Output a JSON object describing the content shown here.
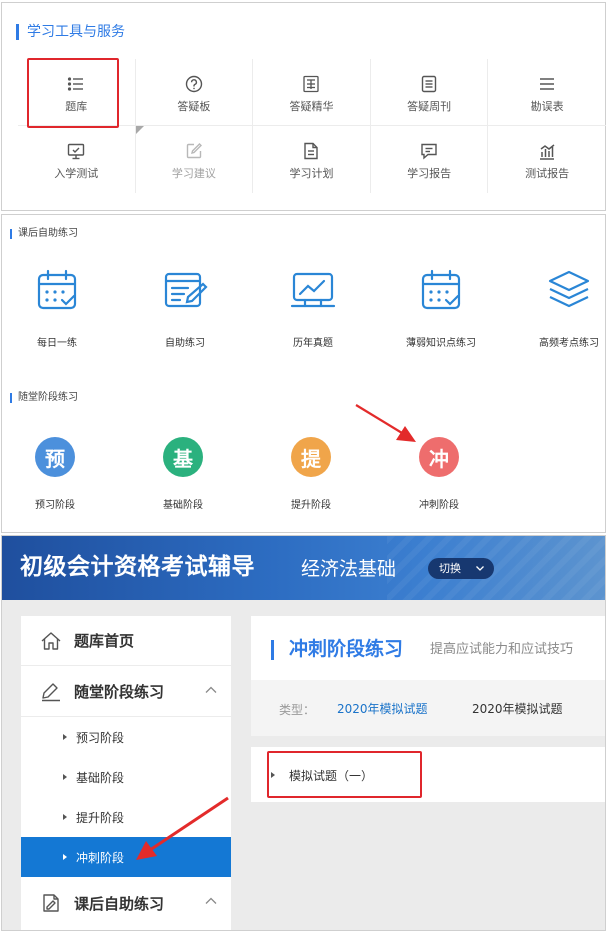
{
  "tools": {
    "title": "学习工具与服务",
    "items": [
      {
        "label": "题库",
        "icon": "list-icon"
      },
      {
        "label": "答疑板",
        "icon": "question-circle-icon"
      },
      {
        "label": "答疑精华",
        "icon": "essence-icon"
      },
      {
        "label": "答疑周刊",
        "icon": "document-icon"
      },
      {
        "label": "勘误表",
        "icon": "menu-lines-icon"
      },
      {
        "label": "入学测试",
        "icon": "monitor-icon"
      },
      {
        "label": "学习建议",
        "icon": "edit-icon"
      },
      {
        "label": "学习计划",
        "icon": "file-text-icon"
      },
      {
        "label": "学习报告",
        "icon": "message-icon"
      },
      {
        "label": "测试报告",
        "icon": "bar-chart-icon"
      }
    ]
  },
  "practice": {
    "after_class_title": "课后自助练习",
    "after_class_items": [
      {
        "label": "每日一练",
        "icon": "calendar-check-icon"
      },
      {
        "label": "自助练习",
        "icon": "writing-icon"
      },
      {
        "label": "历年真题",
        "icon": "monitor-chart-icon"
      },
      {
        "label": "薄弱知识点练习",
        "icon": "calendar-check-icon"
      },
      {
        "label": "高频考点练习",
        "icon": "layers-icon"
      }
    ],
    "in_class_title": "随堂阶段练习",
    "stages": [
      {
        "char": "预",
        "label": "预习阶段",
        "color": "#4c90dc"
      },
      {
        "char": "基",
        "label": "基础阶段",
        "color": "#2bb17e"
      },
      {
        "char": "提",
        "label": "提升阶段",
        "color": "#f0a54a"
      },
      {
        "char": "冲",
        "label": "冲刺阶段",
        "color": "#ee6d6d"
      }
    ]
  },
  "course": {
    "title": "初级会计资格考试辅导",
    "subject": "经济法基础",
    "switch_label": "切换",
    "sidebar": {
      "home": "题库首页",
      "in_class": "随堂阶段练习",
      "stages": [
        "预习阶段",
        "基础阶段",
        "提升阶段",
        "冲刺阶段"
      ],
      "after_class": "课后自助练习"
    },
    "content": {
      "title": "冲刺阶段练习",
      "desc": "提高应试能力和应试技巧",
      "type_label": "类型：",
      "type_options": [
        "2020年模拟试题",
        "2020年模拟试题"
      ],
      "list_item": "模拟试题（一）"
    }
  },
  "colors": {
    "accent": "#2f7be5",
    "highlight": "#e0262c",
    "active_nav": "#1478d4",
    "banner": "#1f4f9e"
  }
}
